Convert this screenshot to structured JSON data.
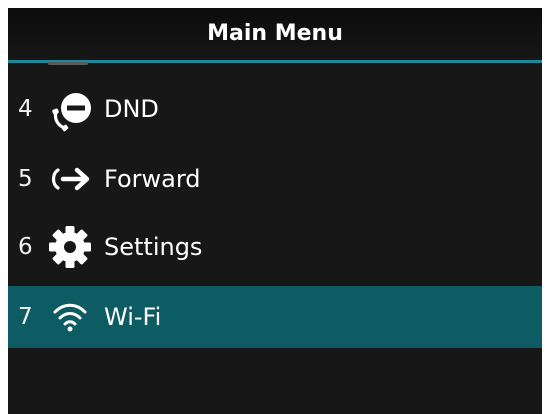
{
  "header": {
    "title": "Main Menu"
  },
  "menu": {
    "items": [
      {
        "number": "4",
        "label": "DND",
        "icon": "dnd-icon"
      },
      {
        "number": "5",
        "label": "Forward",
        "icon": "forward-arrow-icon"
      },
      {
        "number": "6",
        "label": "Settings",
        "icon": "gear-icon"
      },
      {
        "number": "7",
        "label": "Wi-Fi",
        "icon": "wifi-icon",
        "selected": true
      }
    ]
  },
  "colors": {
    "background": "#171717",
    "accent": "#1c8a9c",
    "selected_row": "#0d5c63",
    "text": "#ffffff"
  }
}
